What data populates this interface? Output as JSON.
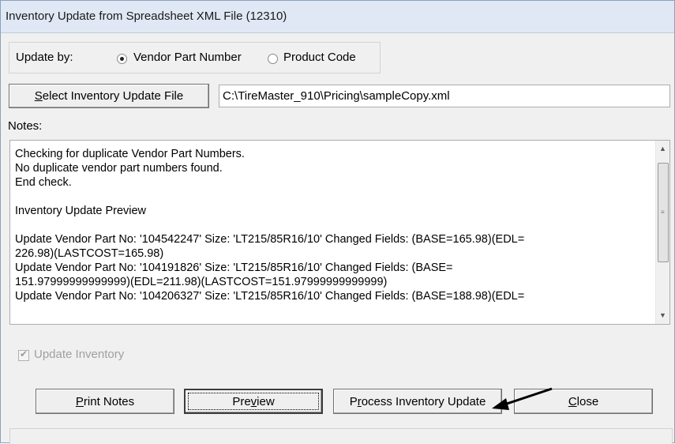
{
  "window": {
    "title": "Inventory Update from Spreadsheet XML File (12310)"
  },
  "update_by": {
    "label": "Update by:",
    "options": [
      {
        "label": "Vendor Part Number",
        "selected": true
      },
      {
        "label": "Product Code",
        "selected": false
      }
    ]
  },
  "file": {
    "select_button_label": "Select Inventory Update File",
    "select_button_underline": "S",
    "select_button_rest": "elect Inventory Update File",
    "path": "C:\\TireMaster_910\\Pricing\\sampleCopy.xml"
  },
  "notes": {
    "label": "Notes:",
    "lines": [
      "Checking for duplicate Vendor Part Numbers.",
      "No duplicate vendor part numbers found.",
      "End check.",
      "",
      "Inventory Update Preview",
      "",
      "Update Vendor Part No: '104542247' Size: 'LT215/85R16/10' Changed Fields: (BASE=165.98)(EDL=",
      "226.98)(LASTCOST=165.98)",
      "Update Vendor Part No: '104191826' Size: 'LT215/85R16/10' Changed Fields: (BASE=",
      "151.97999999999999)(EDL=211.98)(LASTCOST=151.97999999999999)",
      "Update Vendor Part No: '104206327' Size: 'LT215/85R16/10' Changed Fields: (BASE=188.98)(EDL="
    ]
  },
  "update_inventory": {
    "label": "Update Inventory",
    "checked": true,
    "enabled": false
  },
  "buttons": {
    "print_notes": {
      "pre": "",
      "u": "P",
      "post": "rint Notes"
    },
    "preview": {
      "pre": "Pre",
      "u": "v",
      "post": "iew"
    },
    "process": {
      "pre": "P",
      "u": "r",
      "post": "ocess Inventory Update"
    },
    "close": {
      "pre": "",
      "u": "C",
      "post": "lose"
    }
  }
}
